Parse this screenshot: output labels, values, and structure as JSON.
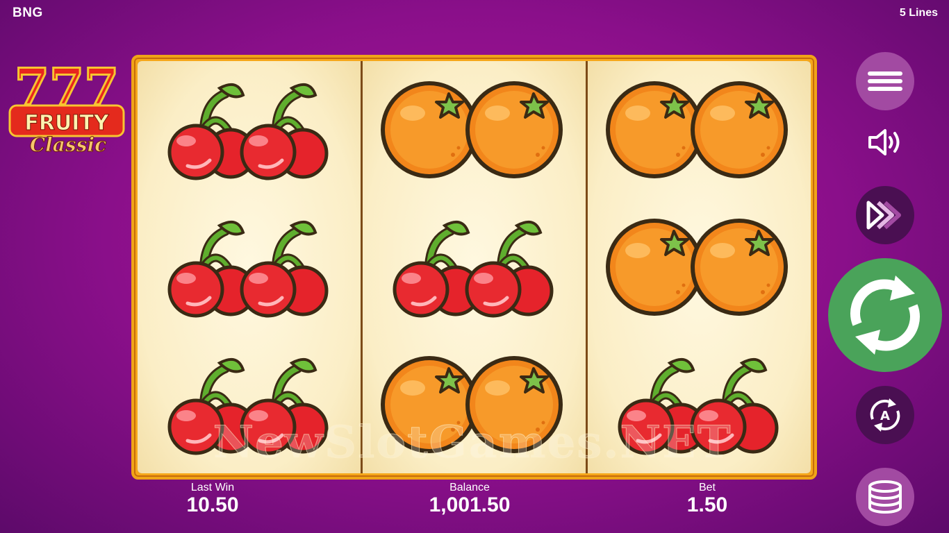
{
  "header": {
    "brand": "BNG",
    "lines": "5 Lines"
  },
  "logo": {
    "line1": "777",
    "line2": "FRUITY",
    "line3": "Classic"
  },
  "reels": [
    [
      "cherry",
      "cherry",
      "cherry"
    ],
    [
      "orange",
      "cherry",
      "orange"
    ],
    [
      "orange",
      "orange",
      "cherry"
    ]
  ],
  "watermark": "NewSlotGames.NET",
  "stats": {
    "last_win_label": "Last Win",
    "last_win_value": "10.50",
    "balance_label": "Balance",
    "balance_value": "1,001.50",
    "bet_label": "Bet",
    "bet_value": "1.50"
  },
  "controls": {
    "menu_icon": "hamburger-menu-icon",
    "sound_icon": "speaker-icon",
    "turbo_icon": "fast-forward-icon",
    "spin_icon": "spin-arrows-icon",
    "autoplay_icon": "autoplay-icon",
    "autoplay_letter": "A",
    "bet_icon": "coin-stack-icon"
  },
  "colors": {
    "background": "#8a0f8a",
    "frame": "#f0a417",
    "spin_button": "#4aa35a",
    "menu_button": "#a24aa2",
    "dark_button": "#4a0f52"
  }
}
